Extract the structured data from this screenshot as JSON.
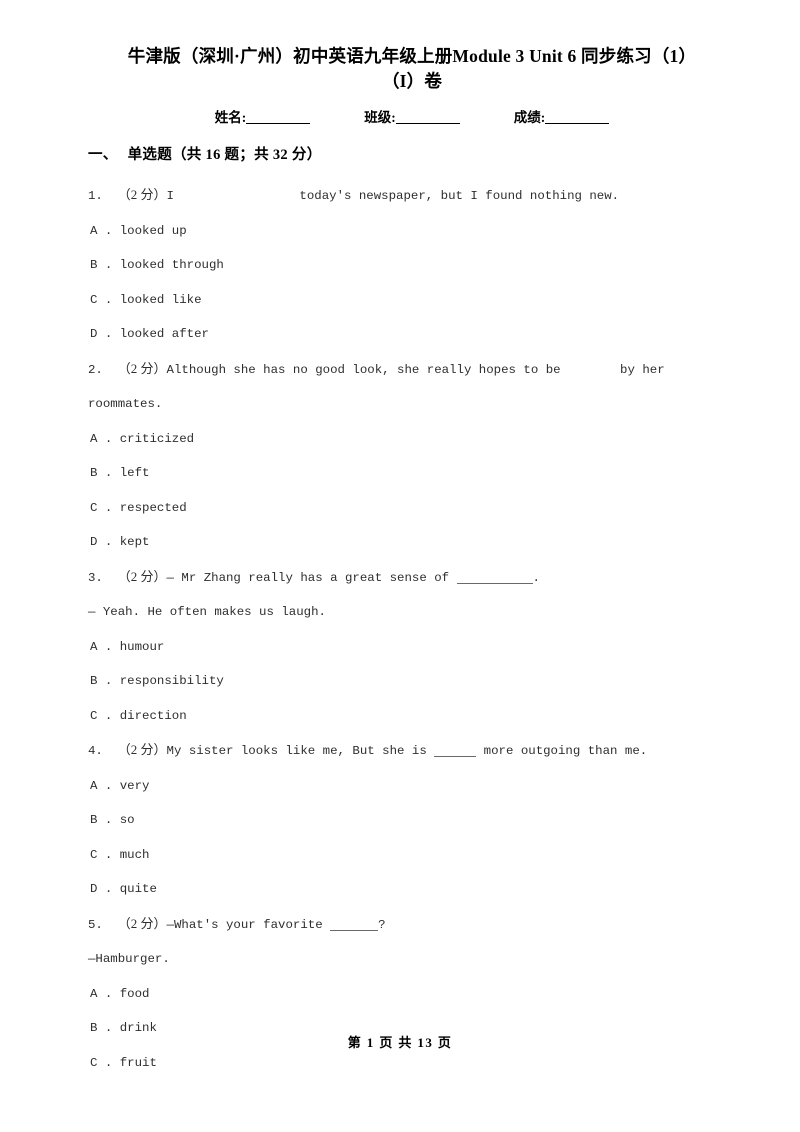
{
  "document": {
    "title_line_1": "牛津版（深圳·广州）初中英语九年级上册Module 3 Unit 6 同步练习（1）",
    "title_line_2": "（I）卷"
  },
  "student_info": {
    "name_label": "姓名:",
    "class_label": "班级:",
    "score_label": "成绩:"
  },
  "section": {
    "number": "一、",
    "title": "单选题（共 16 题；共 32 分）"
  },
  "questions": [
    {
      "index": "1.",
      "marks": "（2 分）",
      "text_before": "I",
      "gap": "wide",
      "text_after": "today's newspaper, but I found nothing new.",
      "options": [
        {
          "letter": "A",
          "text": "looked up"
        },
        {
          "letter": "B",
          "text": "looked through"
        },
        {
          "letter": "C",
          "text": "looked like"
        },
        {
          "letter": "D",
          "text": "looked after"
        }
      ]
    },
    {
      "index": "2.",
      "marks": "（2 分）",
      "text_before": "Although she has no good look, she really hopes to be",
      "gap": "narrow",
      "text_after": "by her roommates.",
      "options": [
        {
          "letter": "A",
          "text": "criticized"
        },
        {
          "letter": "B",
          "text": "left"
        },
        {
          "letter": "C",
          "text": "respected"
        },
        {
          "letter": "D",
          "text": "kept"
        }
      ]
    },
    {
      "index": "3.",
      "marks": "（2 分）",
      "text_before": "— Mr Zhang really has a great sense of",
      "blank": "long",
      "text_after": ".",
      "continuation": "— Yeah. He often makes us laugh.",
      "options": [
        {
          "letter": "A",
          "text": "humour"
        },
        {
          "letter": "B",
          "text": "responsibility"
        },
        {
          "letter": "C",
          "text": "direction"
        }
      ]
    },
    {
      "index": "4.",
      "marks": "（2 分）",
      "text_before": "My sister looks like me, But she is",
      "blank": "short",
      "text_after": "more outgoing than me.",
      "options": [
        {
          "letter": "A",
          "text": "very"
        },
        {
          "letter": "B",
          "text": "so"
        },
        {
          "letter": "C",
          "text": "much"
        },
        {
          "letter": "D",
          "text": "quite"
        }
      ]
    },
    {
      "index": "5.",
      "marks": "（2 分）",
      "text_before": "—What's your favorite",
      "blank": "mid",
      "text_after": "?",
      "continuation": "—Hamburger.",
      "options": [
        {
          "letter": "A",
          "text": "food"
        },
        {
          "letter": "B",
          "text": "drink"
        },
        {
          "letter": "C",
          "text": "fruit"
        }
      ]
    }
  ],
  "footer": {
    "text": "第 1 页 共 13 页"
  }
}
